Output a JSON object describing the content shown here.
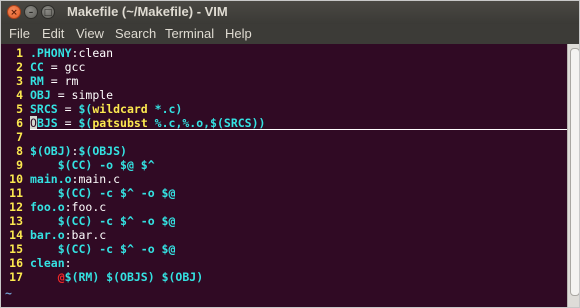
{
  "window": {
    "title": "Makefile (~/Makefile) - VIM",
    "close_glyph": "×",
    "minimize_glyph": "–",
    "maximize_glyph": "□"
  },
  "menu": [
    "File",
    "Edit",
    "View",
    "Search",
    "Terminal",
    "Help"
  ],
  "colors": {
    "background": "#300a24",
    "line_number": "#fce94f",
    "identifier": "#34e2e2",
    "keyword": "#fce94f",
    "variable": "#ad7fa8",
    "special": "#ef2929",
    "text": "#ffffff",
    "tilde": "#729fcf"
  },
  "lines": [
    {
      "num": "1",
      "segs": [
        [
          "target",
          ".PHONY"
        ],
        [
          "text",
          ":clean"
        ]
      ]
    },
    {
      "num": "2",
      "segs": [
        [
          "ident",
          "CC"
        ],
        [
          "text",
          " = gcc"
        ]
      ]
    },
    {
      "num": "3",
      "segs": [
        [
          "ident",
          "RM"
        ],
        [
          "text",
          " = rm"
        ]
      ]
    },
    {
      "num": "4",
      "segs": [
        [
          "ident",
          "OBJ"
        ],
        [
          "text",
          " = simple"
        ]
      ]
    },
    {
      "num": "5",
      "segs": [
        [
          "ident",
          "SRCS"
        ],
        [
          "text",
          " = "
        ],
        [
          "var",
          "$("
        ],
        [
          "kw",
          "wildcard"
        ],
        [
          "var",
          " *.c)"
        ]
      ]
    },
    {
      "num": "6",
      "segs": [
        [
          "cursor",
          "O"
        ],
        [
          "ident",
          "BJS"
        ],
        [
          "text",
          " = "
        ],
        [
          "var",
          "$("
        ],
        [
          "kw",
          "patsubst"
        ],
        [
          "var",
          " %.c,%.o,$(SRCS))"
        ]
      ],
      "underline": true
    },
    {
      "num": "7",
      "segs": []
    },
    {
      "num": "8",
      "segs": [
        [
          "var",
          "$(OBJ)"
        ],
        [
          "text",
          ":"
        ],
        [
          "var",
          "$(OBJS)"
        ]
      ]
    },
    {
      "num": "9",
      "segs": [
        [
          "text",
          "    "
        ],
        [
          "var",
          "$(CC) -o $@ $^"
        ]
      ]
    },
    {
      "num": "10",
      "segs": [
        [
          "ident",
          "main.o"
        ],
        [
          "text",
          ":main.c"
        ]
      ]
    },
    {
      "num": "11",
      "segs": [
        [
          "text",
          "    "
        ],
        [
          "var",
          "$(CC) -c $^ -o $@"
        ]
      ]
    },
    {
      "num": "12",
      "segs": [
        [
          "ident",
          "foo.o"
        ],
        [
          "text",
          ":foo.c"
        ]
      ]
    },
    {
      "num": "13",
      "segs": [
        [
          "text",
          "    "
        ],
        [
          "var",
          "$(CC) -c $^ -o $@"
        ]
      ]
    },
    {
      "num": "14",
      "segs": [
        [
          "ident",
          "bar.o"
        ],
        [
          "text",
          ":bar.c"
        ]
      ]
    },
    {
      "num": "15",
      "segs": [
        [
          "text",
          "    "
        ],
        [
          "var",
          "$(CC) -c $^ -o $@"
        ]
      ]
    },
    {
      "num": "16",
      "segs": [
        [
          "ident",
          "clean"
        ],
        [
          "text",
          ":"
        ]
      ]
    },
    {
      "num": "17",
      "segs": [
        [
          "text",
          "    "
        ],
        [
          "special",
          "@"
        ],
        [
          "var",
          "$(RM) $(OBJS) $(OBJ)"
        ]
      ]
    }
  ],
  "tilde": "~"
}
